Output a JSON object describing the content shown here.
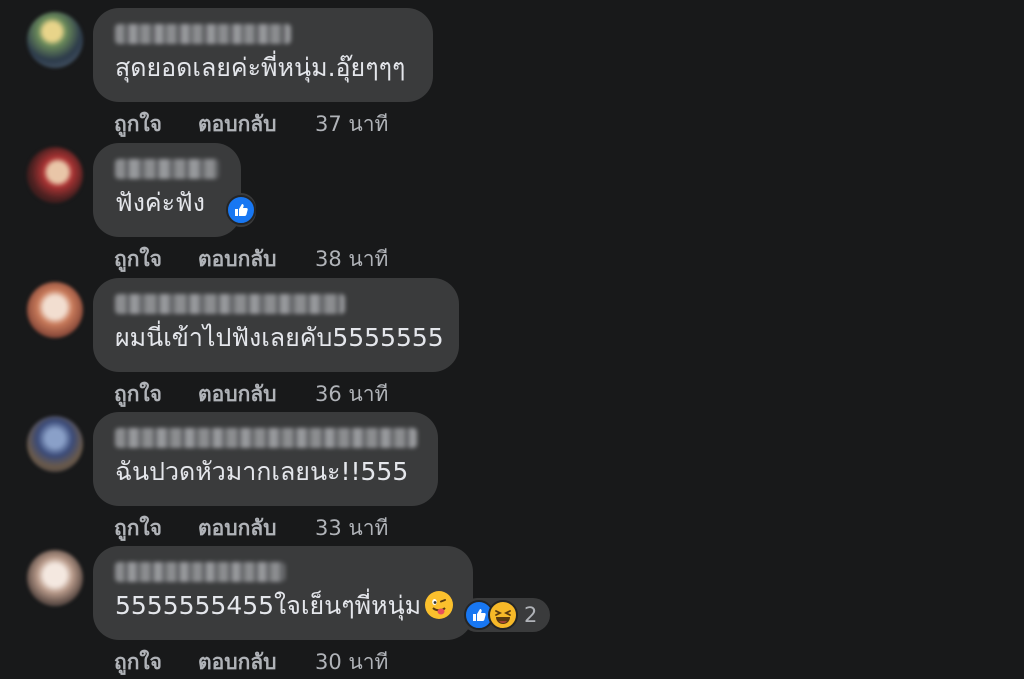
{
  "comments": [
    {
      "text": "สุดยอดเลยค่ะพี่หนุ่ม.อุ๊ยๆๆๆ",
      "like": "ถูกใจ",
      "reply": "ตอบกลับ",
      "time": "37 นาที"
    },
    {
      "text": "ฟังค่ะฟัง",
      "like": "ถูกใจ",
      "reply": "ตอบกลับ",
      "time": "38 นาที",
      "reactions": [
        "like-icon"
      ]
    },
    {
      "text": "ผมนี่เข้าไปฟังเลยคับ5555555",
      "like": "ถูกใจ",
      "reply": "ตอบกลับ",
      "time": "36 นาที"
    },
    {
      "text": "ฉันปวดหัวมากเลยนะ!!555",
      "like": "ถูกใจ",
      "reply": "ตอบกลับ",
      "time": "33 นาที"
    },
    {
      "text": "5555555455ใจเย็นๆพี่หนุ่ม",
      "like": "ถูกใจ",
      "reply": "ตอบกลับ",
      "time": "30 นาที",
      "reactions": [
        "like-icon",
        "haha-icon"
      ],
      "reaction_count": "2"
    }
  ],
  "colors": {
    "background": "#18191a",
    "bubble": "#3a3b3c",
    "text": "#e4e6eb",
    "secondary_text": "#b0b3b8",
    "like_blue": "#1877f2",
    "haha_yellow": "#f7b928"
  }
}
